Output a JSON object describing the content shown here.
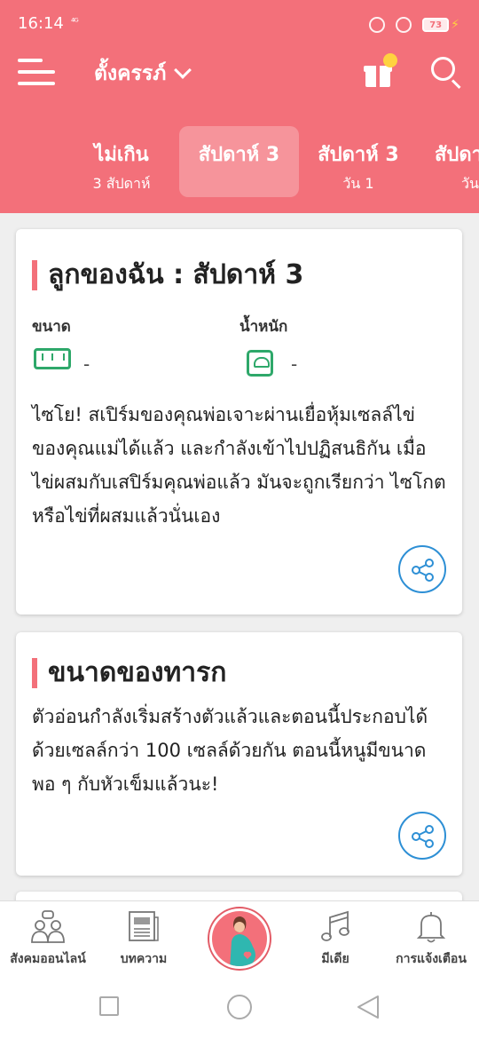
{
  "status": {
    "time": "16:14",
    "signal": "⁴ᴳ",
    "battery": "73"
  },
  "header": {
    "title": "ตั้งครรภ์"
  },
  "tabs": [
    {
      "main": "ไม่เกิน",
      "sub": "3 สัปดาห์"
    },
    {
      "main": "สัปดาห์ 3",
      "sub": ""
    },
    {
      "main": "สัปดาห์ 3",
      "sub": "วัน 1"
    },
    {
      "main": "สัปดา",
      "sub": "วัน"
    }
  ],
  "card1": {
    "title": "ลูกของฉัน :  สัปดาห์ 3",
    "size_label": "ขนาด",
    "size_value": "-",
    "weight_label": "น้ำหนัก",
    "weight_value": "-",
    "body": "ไซโย! สเปิร์มของคุณพ่อเจาะผ่านเยื่อหุ้มเซลล์ไข่ของคุณแม่ได้แล้ว และกำลังเข้าไปปฏิสนธิกัน เมื่อไข่ผสมกับเสปิร์มคุณพ่อแล้ว มันจะถูกเรียกว่า ไซโกต หรือไข่ที่ผสมแล้วนั่นเอง"
  },
  "card2": {
    "title": "ขนาดของทารก",
    "body": "ตัวอ่อนกำลังเริ่มสร้างตัวแล้วและตอนนี้ประกอบได้ด้วยเซลล์กว่า 100 เซลล์ด้วยกัน ตอนนี้หนูมีขนาดพอ ๆ กับหัวเข็มแล้วนะ!"
  },
  "bottom_nav": {
    "community": "สังคมออนไลน์",
    "articles": "บทความ",
    "media": "มีเดีย",
    "notifications": "การแจ้งเตือน"
  },
  "colors": {
    "primary": "#f3707a",
    "accent_green": "#2ea86a",
    "share_blue": "#2d8fd5",
    "gift_dot": "#ffd23f"
  }
}
